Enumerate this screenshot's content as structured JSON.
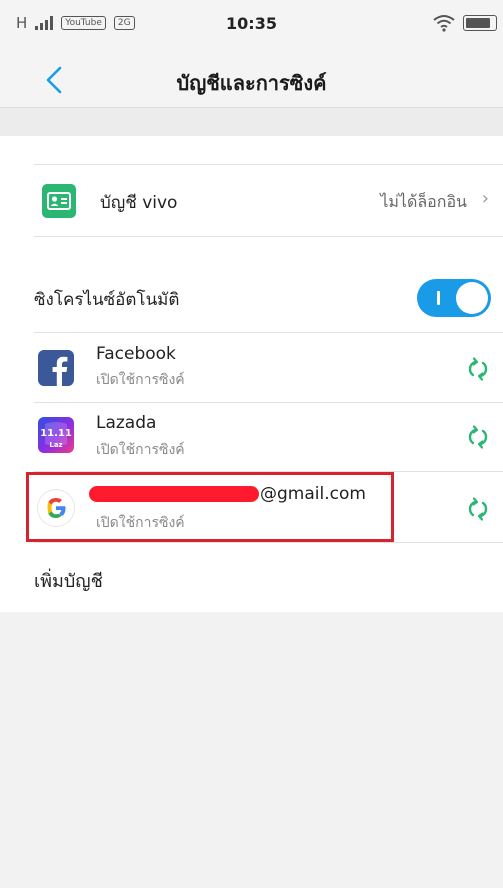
{
  "status_bar": {
    "network": "H",
    "badge_youtube": "YouTube",
    "badge_other": "2G",
    "time": "10:35"
  },
  "header": {
    "title": "บัญชีและการซิงค์"
  },
  "vivo_account": {
    "label": "บัญชี vivo",
    "status": "ไม่ได้ล็อกอิน",
    "chevron": "›"
  },
  "auto_sync": {
    "label": "ซิงโครไนซ์อัตโนมัติ",
    "enabled": true
  },
  "accounts": [
    {
      "name": "Facebook",
      "status": "เปิดใช้การซิงค์",
      "icon": "facebook-icon"
    },
    {
      "name": "Lazada",
      "status": "เปิดใช้การซิงค์",
      "icon": "lazada-icon"
    },
    {
      "name": "@gmail.com",
      "status": "เปิดใช้การซิงค์",
      "icon": "google-icon"
    }
  ],
  "add_account": {
    "label": "เพิ่มบัญชี"
  },
  "colors": {
    "accent": "#1a9be8",
    "vivo_green": "#2bb673",
    "highlight_red": "#d6232d"
  }
}
